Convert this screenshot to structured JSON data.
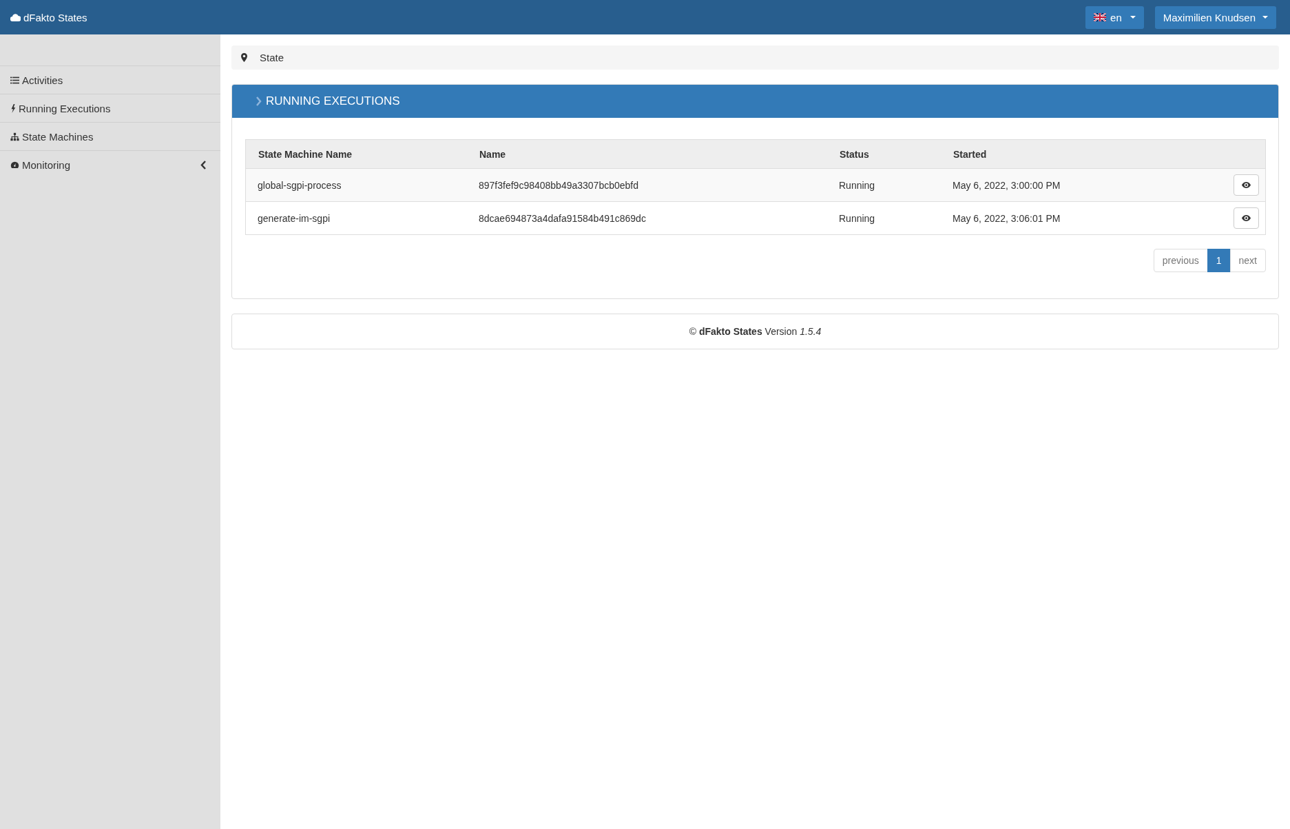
{
  "navbar": {
    "brand": "dFakto States",
    "language": "en",
    "user": "Maximilien Knudsen"
  },
  "sidebar": {
    "items": [
      {
        "label": "Activities"
      },
      {
        "label": "Running Executions"
      },
      {
        "label": "State Machines"
      },
      {
        "label": "Monitoring",
        "expanded": false
      }
    ]
  },
  "breadcrumb": "State",
  "panel": {
    "title": "RUNNING EXECUTIONS",
    "table": {
      "columns": [
        "State Machine Name",
        "Name",
        "Status",
        "Started"
      ],
      "rows": [
        {
          "cells": [
            "global-sgpi-process",
            "897f3fef9c98408bb49a3307bcb0ebfd",
            "Running",
            "May 6, 2022, 3:00:00 PM"
          ]
        },
        {
          "cells": [
            "generate-im-sgpi",
            "8dcae694873a4dafa91584b491c869dc",
            "Running",
            "May 6, 2022, 3:06:01 PM"
          ]
        }
      ]
    },
    "pagination": {
      "previous": "previous",
      "pages": [
        {
          "label": "1",
          "selected": true
        }
      ],
      "next": "next"
    }
  },
  "footer": "© **dFakto States** Version *1.5.4*"
}
